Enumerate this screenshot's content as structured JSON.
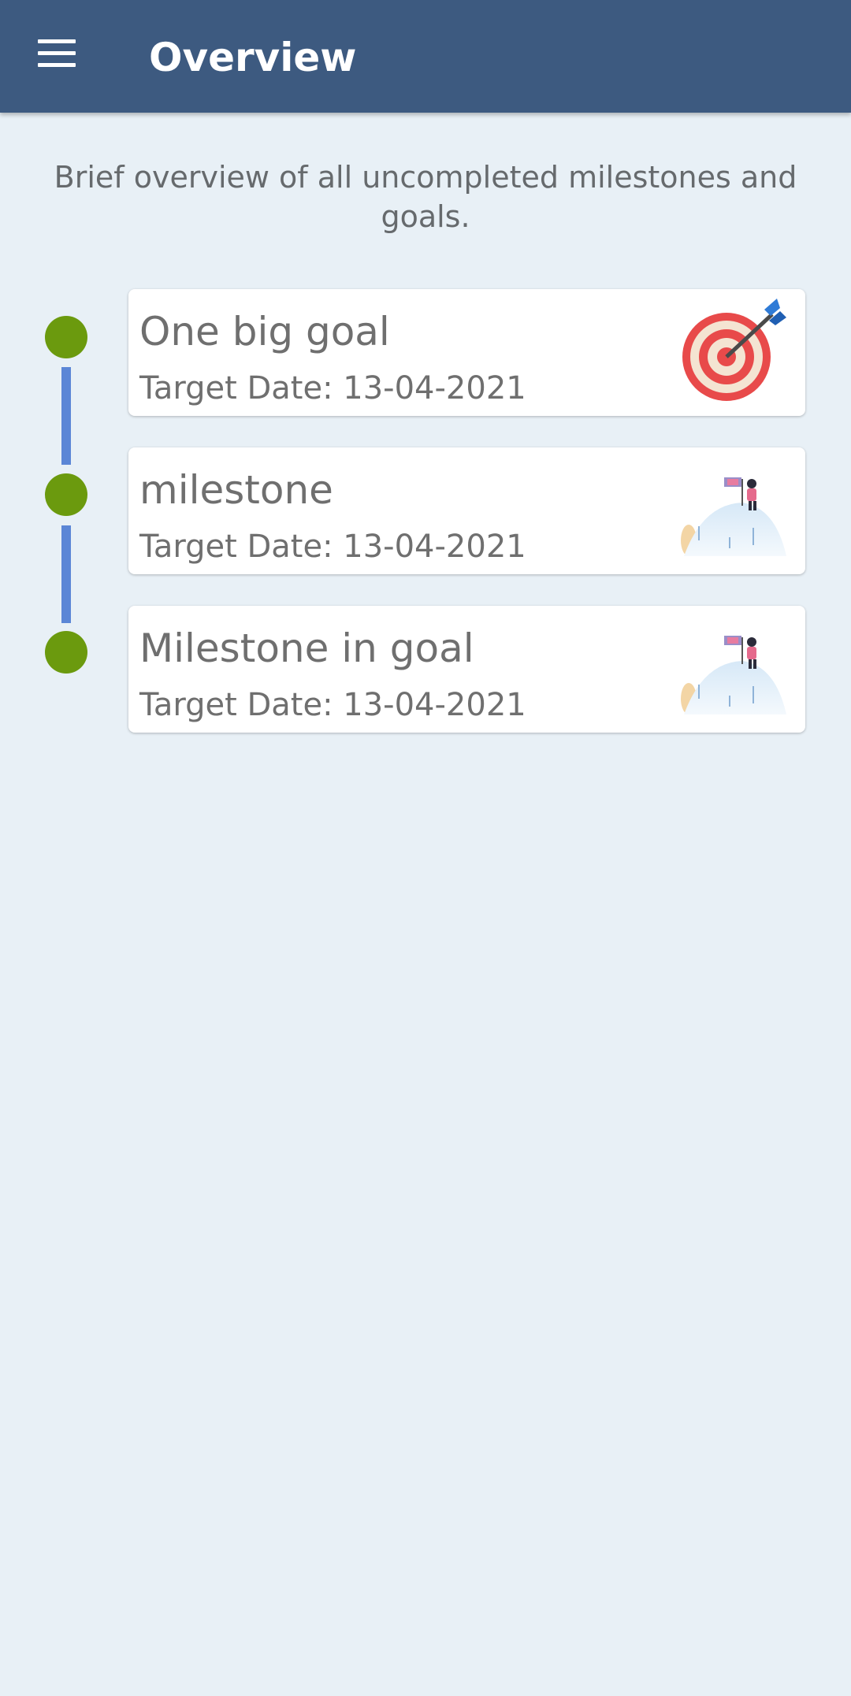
{
  "app_bar": {
    "title": "Overview",
    "menu_icon": "hamburger-menu-icon"
  },
  "intro_text": "Brief overview of all uncompleted milestones and goals.",
  "colors": {
    "app_bar": "#3d5a80",
    "background": "#e8f0f6",
    "timeline_dot": "#6b9a0e",
    "timeline_line": "#5b86d6"
  },
  "items": [
    {
      "title": "One big goal",
      "date": "Target Date: 13-04-2021",
      "icon": "target-icon"
    },
    {
      "title": "milestone",
      "date": "Target Date: 13-04-2021",
      "icon": "mountain-climb-icon"
    },
    {
      "title": "Milestone in goal",
      "date": "Target Date: 13-04-2021",
      "icon": "mountain-climb-icon"
    }
  ]
}
